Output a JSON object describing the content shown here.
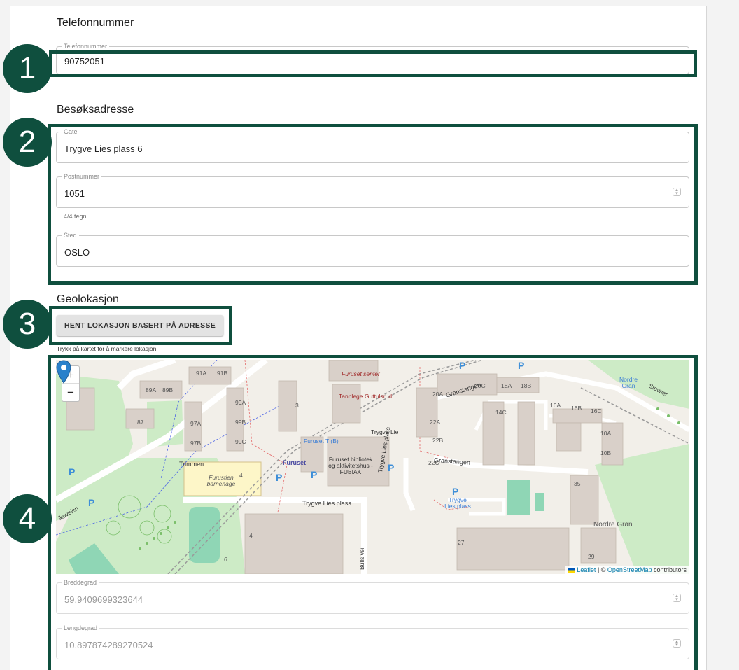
{
  "phone": {
    "section_title": "Telefonnummer",
    "field_label": "Telefonnummer",
    "value": "90752051"
  },
  "address": {
    "section_title": "Besøksadresse",
    "street_label": "Gate",
    "street_value": "Trygve Lies plass 6",
    "postal_label": "Postnummer",
    "postal_value": "1051",
    "postal_counter": "4/4 tegn",
    "place_label": "Sted",
    "place_value": "OSLO"
  },
  "geo": {
    "section_title": "Geolokasjon",
    "fetch_button": "HENT LOKASJON BASERT PÅ ADRESSE",
    "map_hint": "Trykk på kartet for å markere lokasjon",
    "lat_label": "Breddegrad",
    "lat_value": "59.9409699323644",
    "lng_label": "Lengdegrad",
    "lng_value": "10.897874289270524"
  },
  "map": {
    "zoom_in": "+",
    "zoom_out": "−",
    "attribution_leaflet": "Leaflet",
    "attribution_sep": " | © ",
    "attribution_osm": "OpenStreetMap",
    "attribution_tail": " contributors",
    "labels": {
      "furuset_senter": "Furuset senter",
      "tannlege": "Tannlege Guttulsrud",
      "trygve_lie": "Trygve Lie",
      "furuset_t": "Furuset T (B)",
      "furuset": "Furuset",
      "bibliotek": "Furuset bibliotek og aktivitetshus - FUBIAK",
      "trimmen": "Trimmen",
      "barnehage": "Furustien barnehage",
      "trygve_lies_plass": "Trygve Lies plass",
      "trygve_lies_plass_stop": "Trygve Lies plass",
      "trygve_lies_plass_vertical": "Trygve Lies plass",
      "granstangen": "Granstangen",
      "granstangen2": "Granstangen",
      "nordre_gran": "Nordre Gran",
      "nordre_gran_stop": "Nordre Gran",
      "bulls_vei": "Bulls vei",
      "stovner": "Stovner",
      "ikoveien": "ikoveien",
      "n91a": "91A",
      "n91b": "91B",
      "n89a": "89A",
      "n89b": "89B",
      "n87": "87",
      "n99a": "99A",
      "n99b": "99B",
      "n99c": "99C",
      "n97a": "97A",
      "n97b": "97B",
      "n3": "3",
      "n4": "4",
      "n6": "6",
      "n4b": "4",
      "n27": "27",
      "n29": "29",
      "n35": "35",
      "n20a": "20A",
      "n20c": "20C",
      "n18a": "18A",
      "n18b": "18B",
      "n16a": "16A",
      "n16b": "16B",
      "n16c": "16C",
      "n14c": "14C",
      "n22a": "22A",
      "n22b": "22B",
      "n22c": "22C",
      "n10a": "10A",
      "n10b": "10B",
      "p": "P"
    }
  },
  "badges": [
    "1",
    "2",
    "3",
    "4"
  ],
  "colors": {
    "highlight": "#0f4f3e",
    "map_park": "#cdebc6",
    "map_building": "#d9d0c9",
    "map_marker": "#2a81cb"
  }
}
